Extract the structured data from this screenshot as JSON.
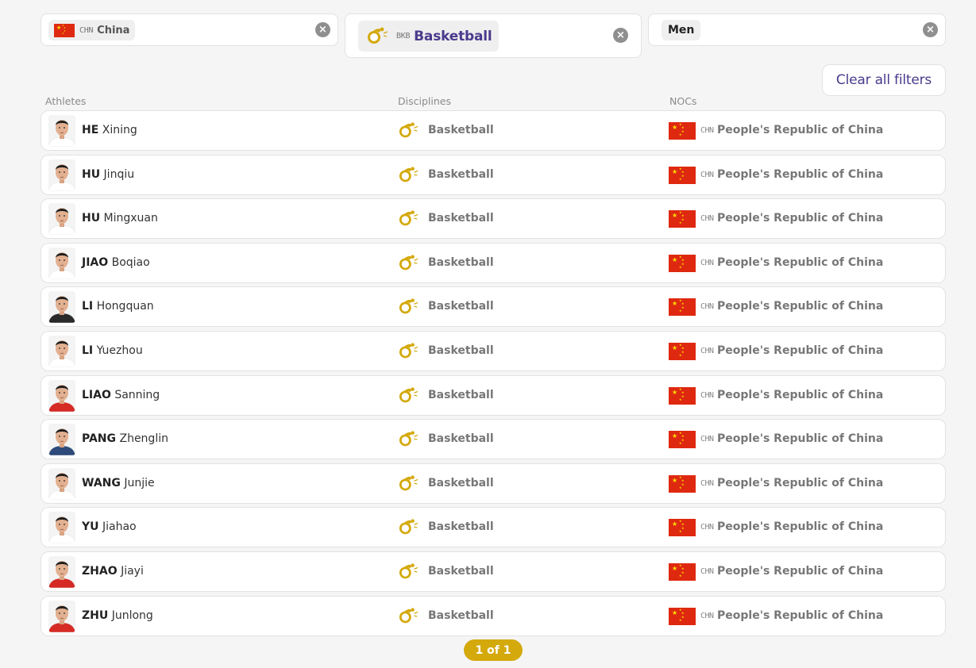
{
  "filters": {
    "country": {
      "code": "CHN",
      "label": "China",
      "flag_icon": "china-flag-icon",
      "clear_icon": "close-icon"
    },
    "discipline": {
      "code": "BKB",
      "label": "Basketball",
      "icon": "basketball-pictogram-icon",
      "clear_icon": "close-icon"
    },
    "gender": {
      "label": "Men",
      "clear_icon": "close-icon"
    },
    "clear_all_label": "Clear all filters"
  },
  "table": {
    "headers": {
      "athletes": "Athletes",
      "disciplines": "Disciplines",
      "nocs": "NOCs"
    },
    "rows": [
      {
        "last": "HE",
        "first": "Xining",
        "discipline": "Basketball",
        "noc_code": "CHN",
        "noc_name": "People's Republic of China",
        "shirt": "#ffffff"
      },
      {
        "last": "HU",
        "first": "Jinqiu",
        "discipline": "Basketball",
        "noc_code": "CHN",
        "noc_name": "People's Republic of China",
        "shirt": "#ffffff"
      },
      {
        "last": "HU",
        "first": "Mingxuan",
        "discipline": "Basketball",
        "noc_code": "CHN",
        "noc_name": "People's Republic of China",
        "shirt": "#ffffff"
      },
      {
        "last": "JIAO",
        "first": "Boqiao",
        "discipline": "Basketball",
        "noc_code": "CHN",
        "noc_name": "People's Republic of China",
        "shirt": "#ffffff"
      },
      {
        "last": "LI",
        "first": "Hongquan",
        "discipline": "Basketball",
        "noc_code": "CHN",
        "noc_name": "People's Republic of China",
        "shirt": "#2a2a2a"
      },
      {
        "last": "LI",
        "first": "Yuezhou",
        "discipline": "Basketball",
        "noc_code": "CHN",
        "noc_name": "People's Republic of China",
        "shirt": "#ffffff"
      },
      {
        "last": "LIAO",
        "first": "Sanning",
        "discipline": "Basketball",
        "noc_code": "CHN",
        "noc_name": "People's Republic of China",
        "shirt": "#d62a25"
      },
      {
        "last": "PANG",
        "first": "Zhenglin",
        "discipline": "Basketball",
        "noc_code": "CHN",
        "noc_name": "People's Republic of China",
        "shirt": "#2d4a7a"
      },
      {
        "last": "WANG",
        "first": "Junjie",
        "discipline": "Basketball",
        "noc_code": "CHN",
        "noc_name": "People's Republic of China",
        "shirt": "#ffffff"
      },
      {
        "last": "YU",
        "first": "Jiahao",
        "discipline": "Basketball",
        "noc_code": "CHN",
        "noc_name": "People's Republic of China",
        "shirt": "#ffffff"
      },
      {
        "last": "ZHAO",
        "first": "Jiayi",
        "discipline": "Basketball",
        "noc_code": "CHN",
        "noc_name": "People's Republic of China",
        "shirt": "#d62a25"
      },
      {
        "last": "ZHU",
        "first": "Junlong",
        "discipline": "Basketball",
        "noc_code": "CHN",
        "noc_name": "People's Republic of China",
        "shirt": "#d62a25"
      }
    ]
  },
  "pagination": {
    "label": "1 of 1"
  },
  "colors": {
    "accent": "#4b3a8c",
    "gold": "#d4a90c",
    "flag_red": "#de2910",
    "flag_star": "#ffde00"
  }
}
